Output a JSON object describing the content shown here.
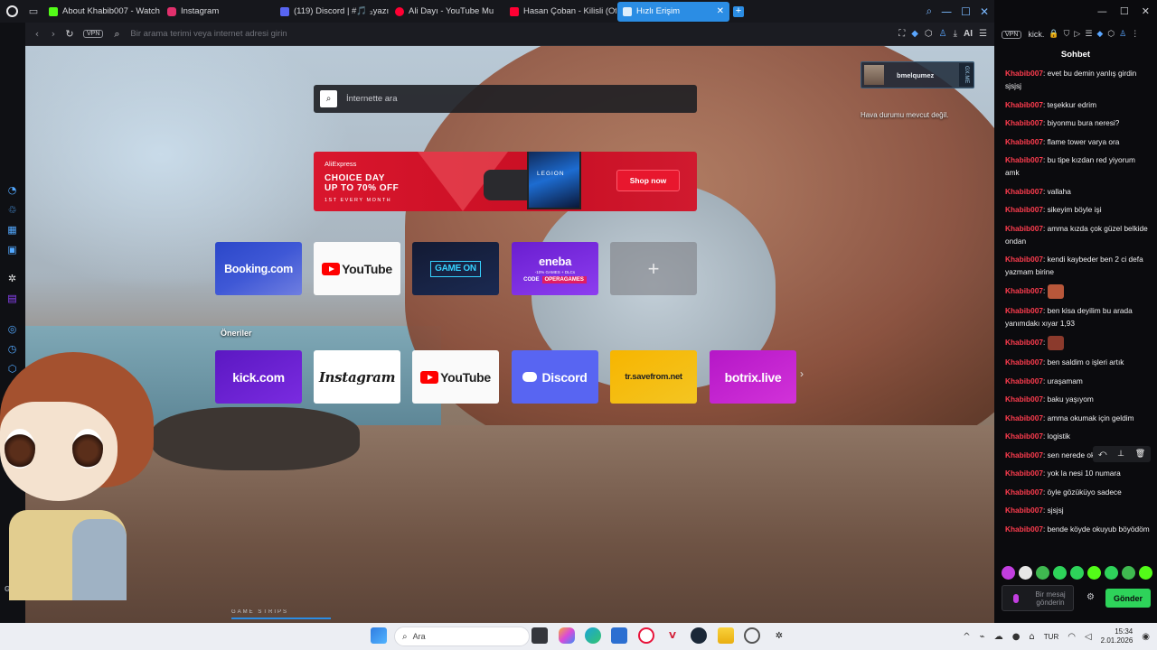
{
  "tabs": [
    {
      "label": "About Khabib007 - Watch",
      "color": "#53fc18"
    },
    {
      "label": "Instagram",
      "color": "#e1306c"
    },
    {
      "label": "(119) Discord | #🎵 ₃yazı",
      "color": "#5865f2"
    },
    {
      "label": "Ali Dayı - YouTube Mu",
      "color": "#ff0033"
    },
    {
      "label": "Hasan Çoban - Kilisli (Offi",
      "color": "#ff0033"
    },
    {
      "label": "Hızlı Erişim",
      "color": "#ffffff",
      "active": true
    }
  ],
  "address_bar": {
    "vpn": "VPN",
    "placeholder": "Bir arama terimi veya internet adresi girin",
    "ai_label": "AI"
  },
  "speed_dial": {
    "search_placeholder": "İnternette ara",
    "banner": {
      "brand": "AliExpress",
      "line1": "CHOICE DAY",
      "line2": "UP TO 70% OFF",
      "line3": "1ST EVERY MONTH",
      "product": "LEGION",
      "cta": "Shop now"
    },
    "dials": [
      {
        "label": "Booking.com"
      },
      {
        "label": "YouTube"
      },
      {
        "label": "GAME ON"
      },
      {
        "label": "eneba",
        "sub": "-10% GAMES + DLCs",
        "code_label": "CODE",
        "code": "OPERAGAMES"
      },
      {
        "label": "+"
      }
    ],
    "suggestions_title": "Öneriler",
    "suggestions": [
      {
        "label": "kick.com"
      },
      {
        "label": "Instagram"
      },
      {
        "label": "YouTube"
      },
      {
        "label": "Discord"
      },
      {
        "label": "tr.savefrom.net"
      },
      {
        "label": "botrix.live"
      }
    ]
  },
  "widgets": {
    "username": "bmelqumez",
    "gx_tag": "GX.ME",
    "weather": "Hava durumu mevcut değil.",
    "game_strips": "GAME STRIPS"
  },
  "sidebar": {
    "gx": "GX"
  },
  "chat_panel": {
    "site": "kick.",
    "vpn": "VPN",
    "title": "Sohbet",
    "messages": [
      {
        "user": "Khabib007",
        "text": "evet bu demin yanlış girdin sjsjsj"
      },
      {
        "user": "Khabib007",
        "text": "teşekkur edrim"
      },
      {
        "user": "Khabib007",
        "text": "biyonmu bura neresi?"
      },
      {
        "user": "Khabib007",
        "text": "flame tower varya ora"
      },
      {
        "user": "Khabib007",
        "text": "bu tipe kızdan red yiyorum amk"
      },
      {
        "user": "Khabib007",
        "text": "vallaha"
      },
      {
        "user": "Khabib007",
        "text": "sikeyim böyle işi"
      },
      {
        "user": "Khabib007",
        "text": "amma kızda çok güzel belkide ondan"
      },
      {
        "user": "Khabib007",
        "text": "kendi kaybeder ben 2 ci defa yazmam birine"
      },
      {
        "user": "Khabib007",
        "text": "",
        "emote": "#b8573a"
      },
      {
        "user": "Khabib007",
        "text": "ben kisa deyilim bu arada yanımdakı хıyar 1,93"
      },
      {
        "user": "Khabib007",
        "text": "",
        "emote": "#8b3a2c"
      },
      {
        "user": "Khabib007",
        "text": "ben saldim o işleri artık"
      },
      {
        "user": "Khabib007",
        "text": "uraşamam"
      },
      {
        "user": "Khabib007",
        "text": "baku yaşıyom"
      },
      {
        "user": "Khabib007",
        "text": "amma okumak için geldim"
      },
      {
        "user": "Khabib007",
        "text": "logistik"
      },
      {
        "user": "Khabib007",
        "text": "sen nerede okuyon"
      },
      {
        "user": "Khabib007",
        "text": "yok la nesi 10 numara"
      },
      {
        "user": "Khabib007",
        "text": "öyle gözüküyo sadece"
      },
      {
        "user": "Khabib007",
        "text": "sjsjsj"
      },
      {
        "user": "Khabib007",
        "text": "bende köyde okuyub böyödöm"
      }
    ],
    "input_placeholder": "Bir mesaj gönderin",
    "send_label": "Gönder"
  },
  "taskbar": {
    "search_placeholder": "Ara",
    "language": "TUR",
    "time": "15:34",
    "date": "2.01.2026"
  }
}
